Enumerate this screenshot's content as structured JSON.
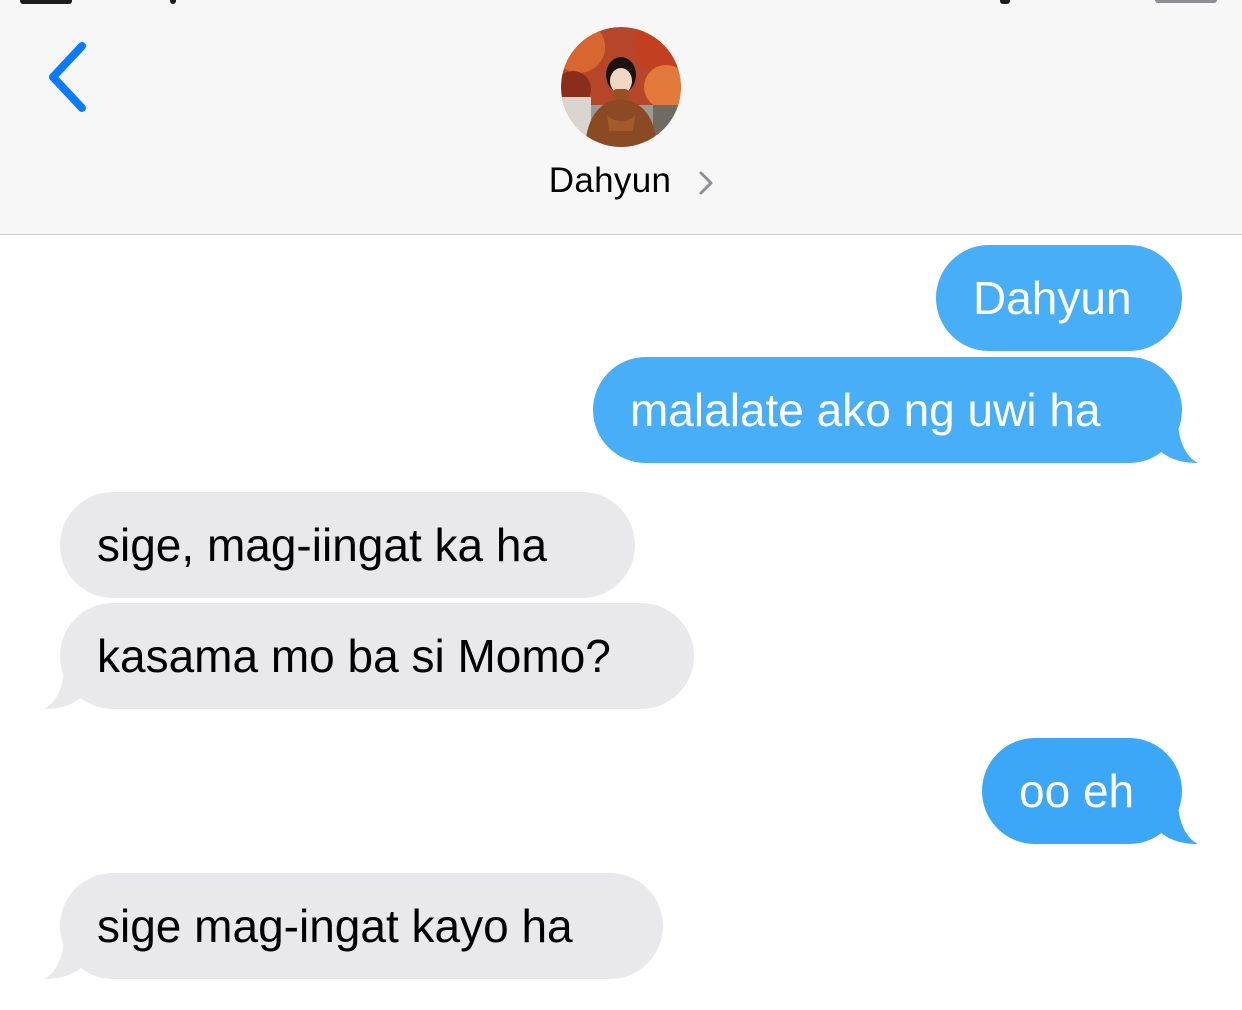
{
  "header": {
    "contact_name": "Dahyun",
    "back_icon": "chevron-left-icon",
    "details_icon": "chevron-right-icon"
  },
  "colors": {
    "sent_bubble": "#47aef7",
    "received_bubble": "#e9e9eb",
    "accent": "#0a7aff",
    "header_bg": "#f7f7f7"
  },
  "messages": [
    {
      "direction": "sent",
      "text": "Dahyun"
    },
    {
      "direction": "sent",
      "text": "malalate ako ng uwi ha"
    },
    {
      "direction": "received",
      "text": "sige, mag-iingat ka ha"
    },
    {
      "direction": "received",
      "text": "kasama mo ba si Momo?"
    },
    {
      "direction": "sent",
      "text": "oo eh"
    },
    {
      "direction": "received",
      "text": "sige mag-ingat kayo ha"
    }
  ]
}
